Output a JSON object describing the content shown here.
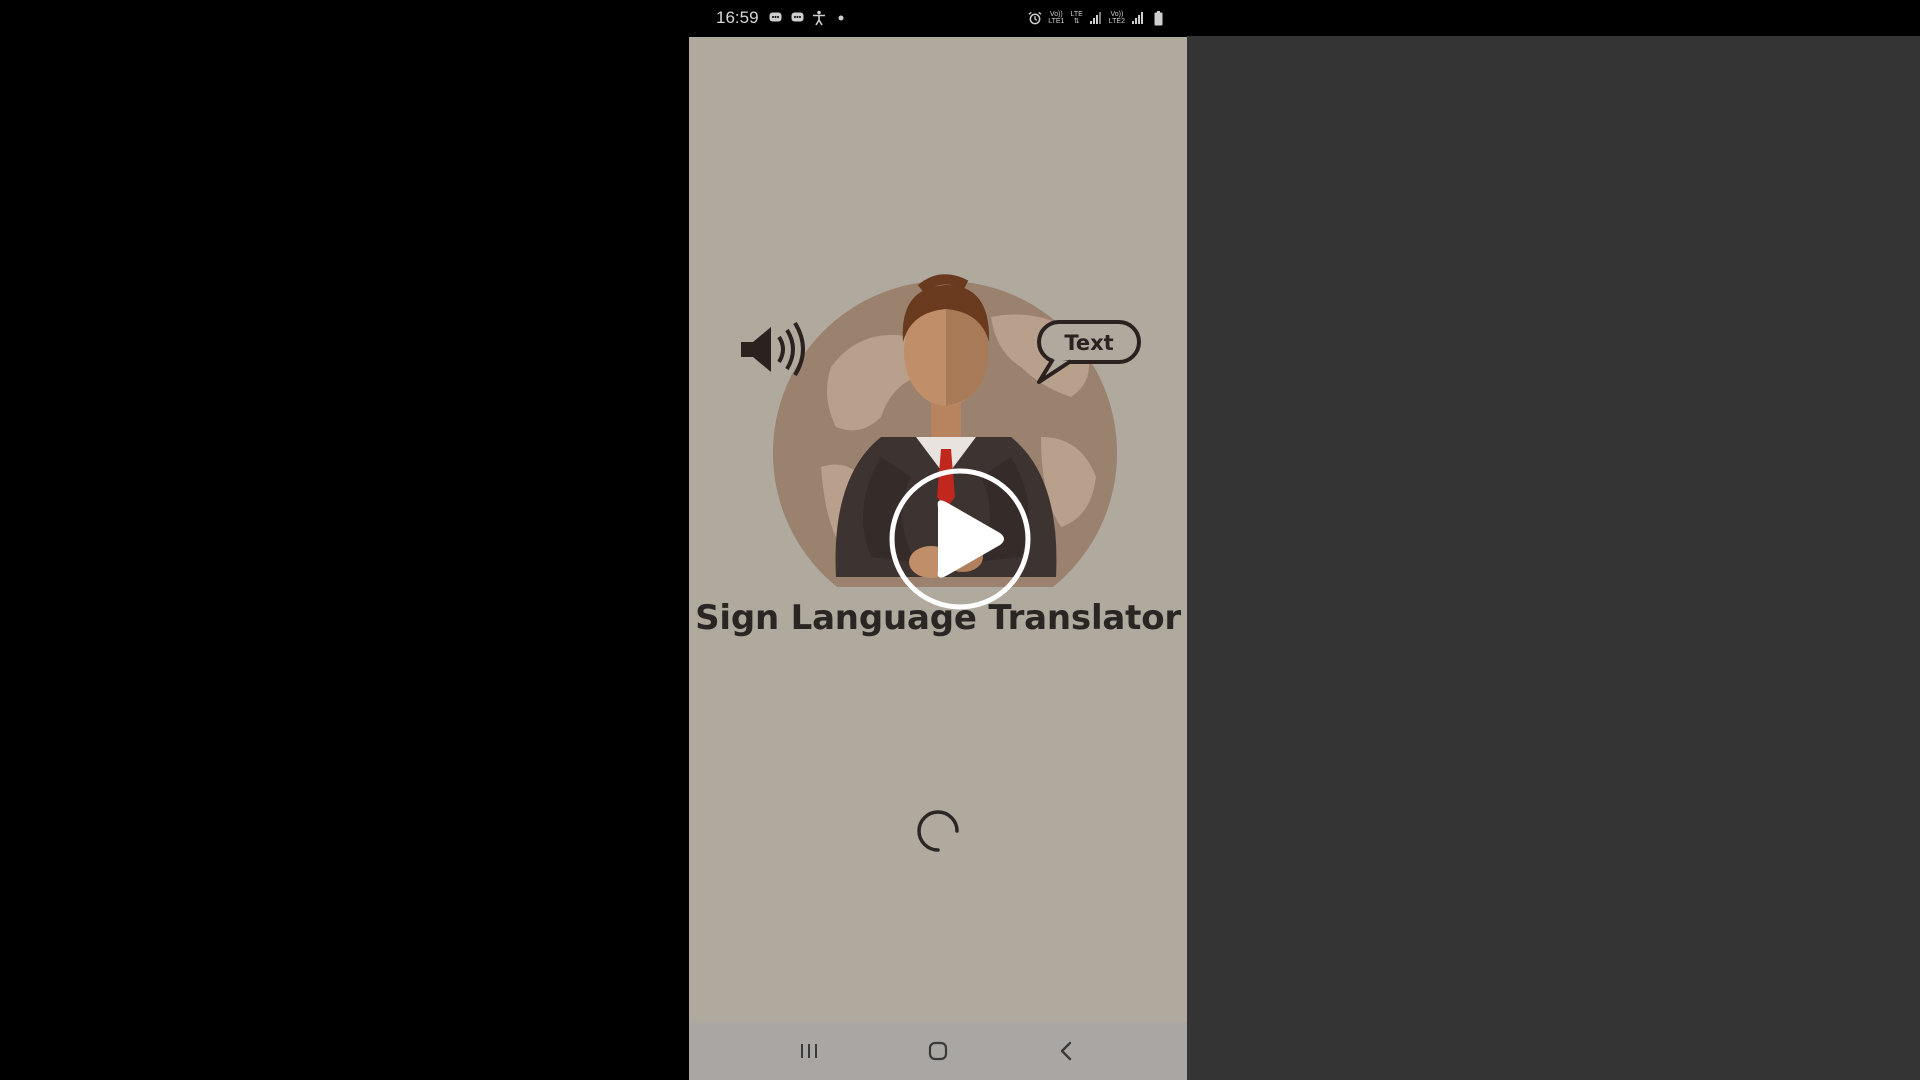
{
  "status_bar": {
    "time": "16:59",
    "left_icons": [
      "chat-bubble-icon",
      "chat-bubble-icon",
      "accessibility-icon",
      "dot-icon"
    ],
    "right_icons": [
      "alarm-icon",
      "volte-lte1-icon",
      "lte-icon",
      "signal-icon",
      "volte-lte2-icon",
      "signal-icon",
      "battery-icon"
    ],
    "volte1_top": "Vo))",
    "volte1_bottom": "LTE1",
    "lte_label": "LTE",
    "volte2_top": "Vo))",
    "volte2_bottom": "LTE2"
  },
  "app": {
    "title": "Sign Language Translator",
    "speech_bubble_text": "Text",
    "background_color": "#b0a99e",
    "loading": true
  },
  "nav_bar": {
    "buttons": [
      "recent-apps-icon",
      "home-icon",
      "back-icon"
    ]
  },
  "colors": {
    "right_pane": "#343434",
    "title_text": "#2a2624",
    "globe": "#8a7260",
    "tie": "#c0281e",
    "suit": "#3d3330"
  }
}
